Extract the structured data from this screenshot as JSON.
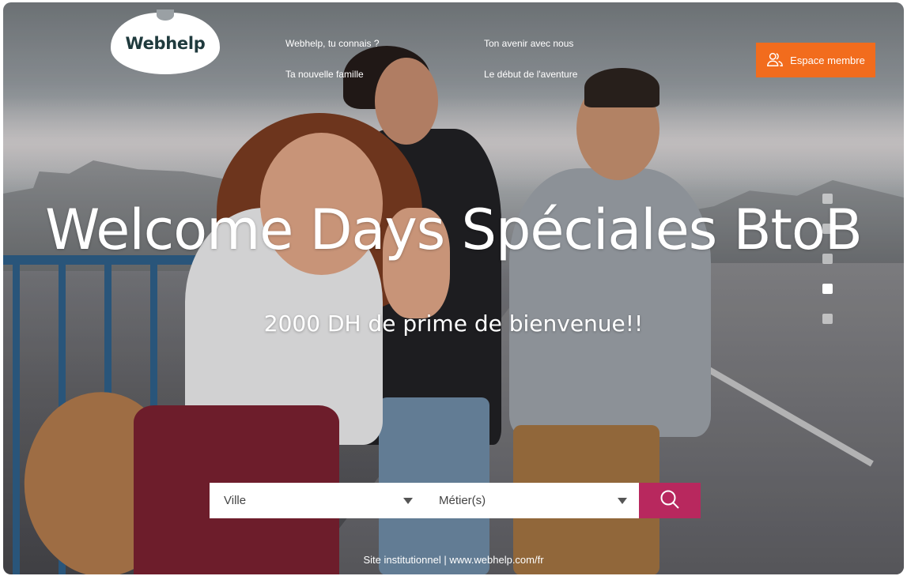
{
  "header": {
    "logo_text": "Webhelp",
    "nav": [
      {
        "label": "Webhelp, tu connais ?"
      },
      {
        "label": "Ton avenir avec nous"
      },
      {
        "label": "Ta nouvelle famille"
      },
      {
        "label": "Le début de l'aventure"
      }
    ],
    "member_button": {
      "label": "Espace membre",
      "icon": "user-group-icon"
    }
  },
  "hero": {
    "title": "Welcome Days Spéciales BtoB",
    "subtitle": "2000 DH de prime de bienvenue!!",
    "slider": {
      "count": 5,
      "active_index": 3
    }
  },
  "search": {
    "city": {
      "label": "Ville"
    },
    "job": {
      "label": "Métier(s)"
    },
    "button_icon": "search-icon"
  },
  "footer": {
    "link_text": "Site institutionnel | www.webhelp.com/fr"
  },
  "colors": {
    "brand_orange": "#f26c1d",
    "search_button": "#b8285e",
    "logo_text": "#1f3a3d"
  }
}
